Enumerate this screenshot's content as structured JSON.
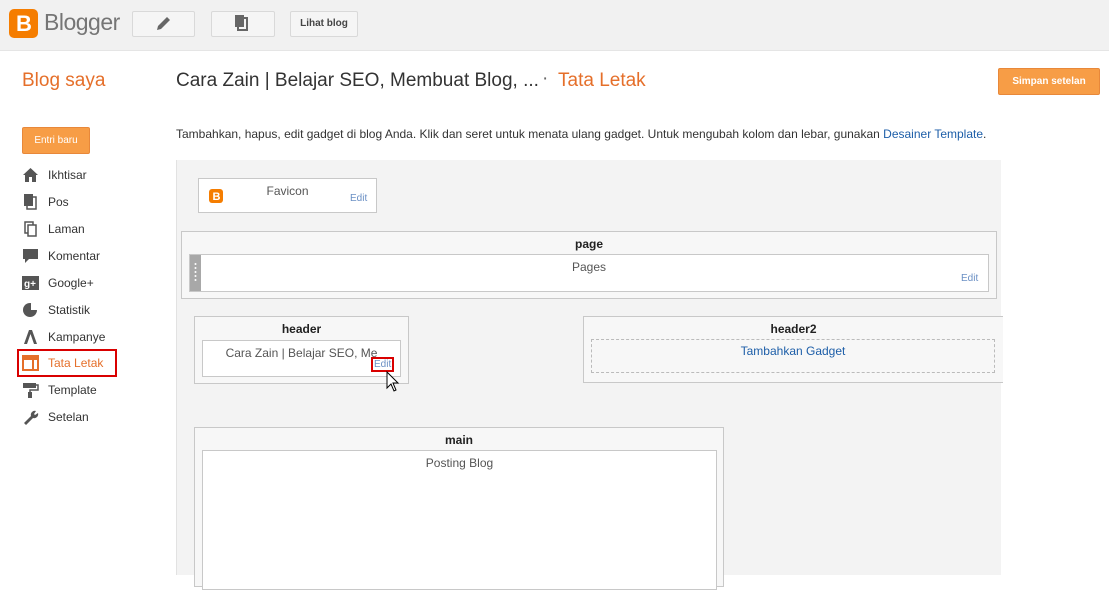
{
  "topbar": {
    "logo_text": "Blogger",
    "view_blog_label": "Lihat blog"
  },
  "header": {
    "my_blogs": "Blog saya",
    "blog_title": "Cara Zain | Belajar SEO, Membuat Blog, ...",
    "separator": "·",
    "page_name": "Tata Letak",
    "save_label": "Simpan setelan"
  },
  "sidebar": {
    "new_post_label": "Entri baru",
    "items": [
      {
        "label": "Ikhtisar",
        "icon": "home-icon"
      },
      {
        "label": "Pos",
        "icon": "posts-icon"
      },
      {
        "label": "Laman",
        "icon": "pages-icon"
      },
      {
        "label": "Komentar",
        "icon": "comment-icon"
      },
      {
        "label": "Google+",
        "icon": "google-plus-icon"
      },
      {
        "label": "Statistik",
        "icon": "pie-chart-icon"
      },
      {
        "label": "Kampanye",
        "icon": "campaign-icon"
      },
      {
        "label": "Tata Letak",
        "icon": "layout-icon",
        "active": true
      },
      {
        "label": "Template",
        "icon": "paint-roller-icon"
      },
      {
        "label": "Setelan",
        "icon": "wrench-icon"
      }
    ]
  },
  "intro": {
    "text": "Tambahkan, hapus, edit gadget di blog Anda. Klik dan seret untuk menata ulang gadget. Untuk mengubah kolom dan lebar, gunakan ",
    "link": "Desainer Template",
    "suffix": "."
  },
  "layout": {
    "favicon": {
      "title": "Favicon",
      "edit": "Edit"
    },
    "page_section": {
      "title": "page",
      "gadget_title": "Pages",
      "edit": "Edit"
    },
    "header_section": {
      "title": "header",
      "gadget_title": "Cara Zain | Belajar SEO, Me",
      "edit": "Edit"
    },
    "header2_section": {
      "title": "header2",
      "add_gadget": "Tambahkan Gadget"
    },
    "main_section": {
      "title": "main",
      "gadget_title": "Posting Blog"
    }
  },
  "colors": {
    "accent": "#e56f2a",
    "button_orange": "#f79d46",
    "link_blue": "#1d5ea8",
    "highlight_red": "#d90000"
  }
}
